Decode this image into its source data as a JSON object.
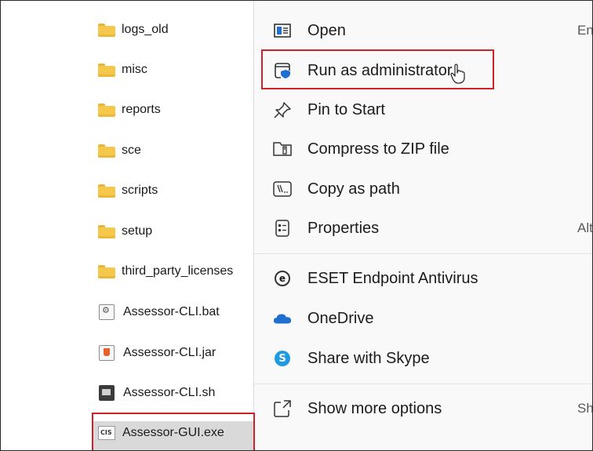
{
  "files": [
    {
      "name": "logs_old",
      "type": "folder",
      "icon": "folder-icon"
    },
    {
      "name": "misc",
      "type": "folder",
      "icon": "folder-icon"
    },
    {
      "name": "reports",
      "type": "folder",
      "icon": "folder-icon"
    },
    {
      "name": "sce",
      "type": "folder",
      "icon": "folder-icon"
    },
    {
      "name": "scripts",
      "type": "folder",
      "icon": "folder-icon"
    },
    {
      "name": "setup",
      "type": "folder",
      "icon": "folder-icon"
    },
    {
      "name": "third_party_licenses",
      "type": "folder",
      "icon": "folder-icon"
    },
    {
      "name": "Assessor-CLI.bat",
      "type": "file",
      "icon": "batch-file-icon"
    },
    {
      "name": "Assessor-CLI.jar",
      "type": "file",
      "icon": "java-file-icon"
    },
    {
      "name": "Assessor-CLI.sh",
      "type": "file",
      "icon": "shell-script-icon"
    },
    {
      "name": "Assessor-GUI.exe",
      "type": "file",
      "icon": "cis-exe-icon",
      "icon_text": "CIS",
      "selected": true
    }
  ],
  "context_menu": {
    "items": [
      {
        "label": "Open",
        "shortcut": "En",
        "icon": "open-window-icon"
      },
      {
        "label": "Run as administrator",
        "shortcut": "",
        "icon": "shield-window-icon",
        "highlighted": true
      },
      {
        "label": "Pin to Start",
        "shortcut": "",
        "icon": "pin-icon"
      },
      {
        "label": "Compress to ZIP file",
        "shortcut": "",
        "icon": "zip-folder-icon"
      },
      {
        "label": "Copy as path",
        "shortcut": "",
        "icon": "copy-path-icon"
      },
      {
        "label": "Properties",
        "shortcut": "Alt",
        "icon": "properties-icon"
      },
      {
        "label": "ESET Endpoint Antivirus",
        "shortcut": "",
        "icon": "eset-icon",
        "icon_text": "e"
      },
      {
        "label": "OneDrive",
        "shortcut": "",
        "icon": "onedrive-cloud-icon"
      },
      {
        "label": "Share with Skype",
        "shortcut": "",
        "icon": "skype-icon",
        "icon_text": "S"
      },
      {
        "label": "Show more options",
        "shortcut": "Sh",
        "icon": "show-more-icon"
      }
    ]
  },
  "colors": {
    "highlight_border": "#d12027",
    "menu_background": "#f9f9f9",
    "folder": "#f5c84c",
    "accent_blue": "#0067c0",
    "onedrive_blue": "#1f6fd0",
    "skype_blue": "#1e9be0"
  }
}
